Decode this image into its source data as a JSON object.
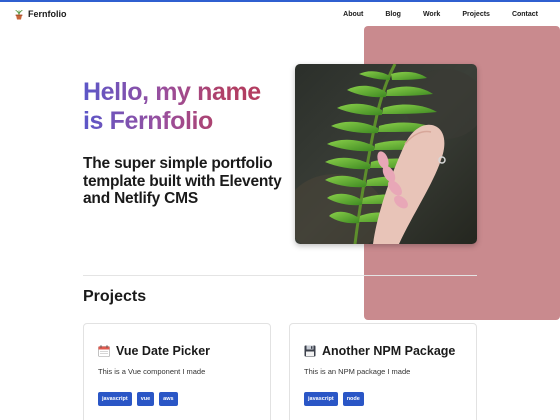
{
  "site": {
    "name": "Fernfolio",
    "logo_icon": "potted-plant-icon",
    "accent_color": "#2f5fd0",
    "panel_color": "#c98a8e"
  },
  "nav": {
    "links": [
      "About",
      "Blog",
      "Work",
      "Projects",
      "Contact"
    ]
  },
  "hero": {
    "title": "Hello, my name is Fernfolio",
    "subtitle": "The super simple portfolio template built with Eleventy and Netlify CMS",
    "image_icon": "fern-in-hand-photo"
  },
  "projects": {
    "heading": "Projects",
    "items": [
      {
        "icon": "calendar-icon",
        "title": "Vue Date Picker",
        "description": "This is a Vue component I made",
        "tags": [
          "javascript",
          "vue",
          "aws"
        ]
      },
      {
        "icon": "floppy-disk-icon",
        "title": "Another NPM Package",
        "description": "This is an NPM package I made",
        "tags": [
          "javascript",
          "node"
        ]
      }
    ]
  }
}
